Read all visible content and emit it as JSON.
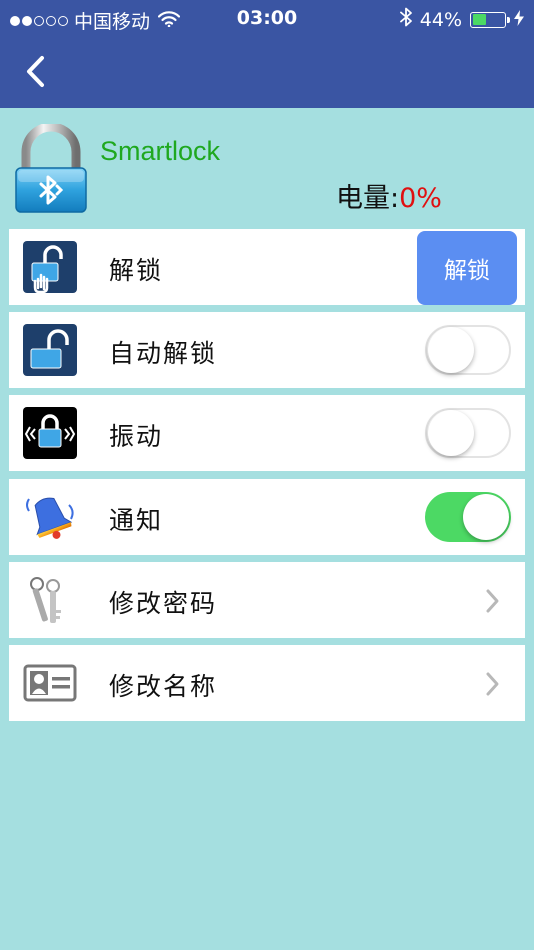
{
  "status_bar": {
    "carrier": "中国移动",
    "time": "03:00",
    "battery_percent": "44%",
    "battery_level": 0.44,
    "signal_bars_filled": 2,
    "signal_bars_total": 5
  },
  "nav": {
    "back_icon": "chevron-left-icon"
  },
  "device": {
    "name": "Smartlock",
    "battery_label": "电量:",
    "battery_value": "0%",
    "icon": "bluetooth-padlock-icon"
  },
  "rows": [
    {
      "label": "解锁",
      "icon": "tap-unlock-icon",
      "control": "button",
      "button_label": "解锁"
    },
    {
      "label": "自动解锁",
      "icon": "open-padlock-icon",
      "control": "toggle",
      "on": false
    },
    {
      "label": "振动",
      "icon": "vibrate-lock-icon",
      "control": "toggle",
      "on": false
    },
    {
      "label": "通知",
      "icon": "bell-icon",
      "control": "toggle",
      "on": true
    },
    {
      "label": "修改密码",
      "icon": "keys-icon",
      "control": "chevron"
    },
    {
      "label": "修改名称",
      "icon": "id-card-icon",
      "control": "chevron"
    }
  ],
  "colors": {
    "nav_background": "#3a55a3",
    "page_background": "#a5dfe0",
    "device_name": "#1fa81f",
    "battery_value": "#e01010",
    "unlock_button": "#5b8ef2",
    "toggle_on": "#4cd964"
  }
}
